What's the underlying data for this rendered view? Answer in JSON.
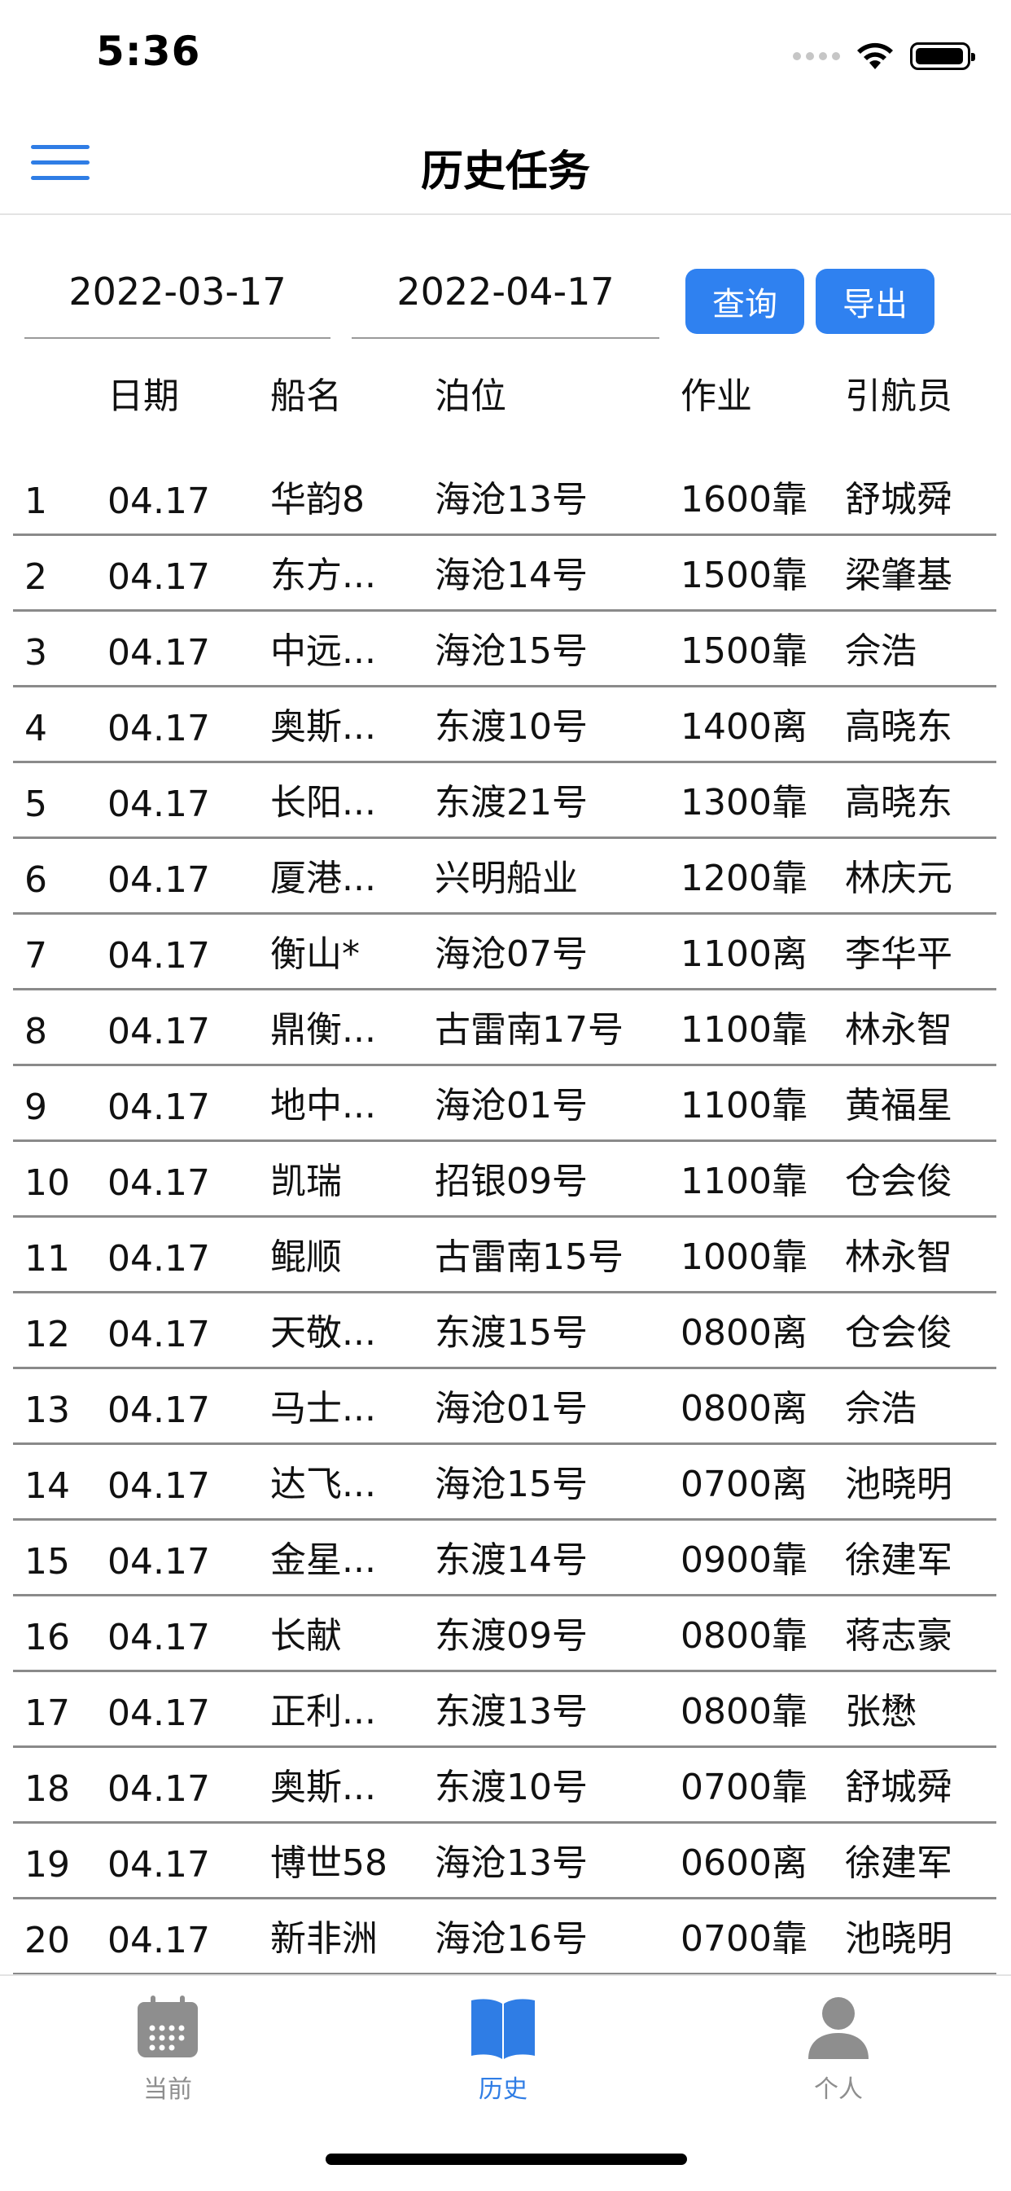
{
  "status_bar": {
    "time": "5:36"
  },
  "nav": {
    "title": "历史任务"
  },
  "query": {
    "start_date": "2022-03-17",
    "end_date": "2022-04-17",
    "query_label": "查询",
    "export_label": "导出"
  },
  "table": {
    "headers": [
      "日期",
      "船名",
      "泊位",
      "作业",
      "引航员"
    ],
    "rows": [
      {
        "idx": "1",
        "date": "04.17",
        "ship": "华韵8",
        "berth": "海沧13号",
        "job": "1600靠",
        "pilot": "舒城舜"
      },
      {
        "idx": "2",
        "date": "04.17",
        "ship": "东方...",
        "berth": "海沧14号",
        "job": "1500靠",
        "pilot": "梁肇基"
      },
      {
        "idx": "3",
        "date": "04.17",
        "ship": "中远...",
        "berth": "海沧15号",
        "job": "1500靠",
        "pilot": "佘浩"
      },
      {
        "idx": "4",
        "date": "04.17",
        "ship": "奥斯...",
        "berth": "东渡10号",
        "job": "1400离",
        "pilot": "高晓东"
      },
      {
        "idx": "5",
        "date": "04.17",
        "ship": "长阳...",
        "berth": "东渡21号",
        "job": "1300靠",
        "pilot": "高晓东"
      },
      {
        "idx": "6",
        "date": "04.17",
        "ship": "厦港...",
        "berth": "兴明船业",
        "job": "1200靠",
        "pilot": "林庆元"
      },
      {
        "idx": "7",
        "date": "04.17",
        "ship": "衡山*",
        "berth": "海沧07号",
        "job": "1100离",
        "pilot": "李华平"
      },
      {
        "idx": "8",
        "date": "04.17",
        "ship": "鼎衡...",
        "berth": "古雷南17号",
        "job": "1100靠",
        "pilot": "林永智"
      },
      {
        "idx": "9",
        "date": "04.17",
        "ship": "地中...",
        "berth": "海沧01号",
        "job": "1100靠",
        "pilot": "黄福星"
      },
      {
        "idx": "10",
        "date": "04.17",
        "ship": "凯瑞",
        "berth": "招银09号",
        "job": "1100靠",
        "pilot": "仓会俊"
      },
      {
        "idx": "11",
        "date": "04.17",
        "ship": "鲲顺",
        "berth": "古雷南15号",
        "job": "1000靠",
        "pilot": "林永智"
      },
      {
        "idx": "12",
        "date": "04.17",
        "ship": "天敬...",
        "berth": "东渡15号",
        "job": "0800离",
        "pilot": "仓会俊"
      },
      {
        "idx": "13",
        "date": "04.17",
        "ship": "马士...",
        "berth": "海沧01号",
        "job": "0800离",
        "pilot": "佘浩"
      },
      {
        "idx": "14",
        "date": "04.17",
        "ship": "达飞...",
        "berth": "海沧15号",
        "job": "0700离",
        "pilot": "池晓明"
      },
      {
        "idx": "15",
        "date": "04.17",
        "ship": "金星...",
        "berth": "东渡14号",
        "job": "0900靠",
        "pilot": "徐建军"
      },
      {
        "idx": "16",
        "date": "04.17",
        "ship": "长献",
        "berth": "东渡09号",
        "job": "0800靠",
        "pilot": "蒋志豪"
      },
      {
        "idx": "17",
        "date": "04.17",
        "ship": "正利...",
        "berth": "东渡13号",
        "job": "0800靠",
        "pilot": "张懋"
      },
      {
        "idx": "18",
        "date": "04.17",
        "ship": "奥斯...",
        "berth": "东渡10号",
        "job": "0700靠",
        "pilot": "舒城舜"
      },
      {
        "idx": "19",
        "date": "04.17",
        "ship": "博世58",
        "berth": "海沧13号",
        "job": "0600离",
        "pilot": "徐建军"
      },
      {
        "idx": "20",
        "date": "04.17",
        "ship": "新非洲",
        "berth": "海沧16号",
        "job": "0700靠",
        "pilot": "池晓明"
      }
    ]
  },
  "tabs": [
    {
      "label": "当前",
      "icon": "calendar-icon",
      "active": false
    },
    {
      "label": "历史",
      "icon": "book-icon",
      "active": true
    },
    {
      "label": "个人",
      "icon": "person-icon",
      "active": false
    }
  ],
  "colors": {
    "accent": "#2f7de5",
    "button": "#2f81f0",
    "inactive": "#8e8e8e",
    "row_divider": "#8a8a8a"
  }
}
